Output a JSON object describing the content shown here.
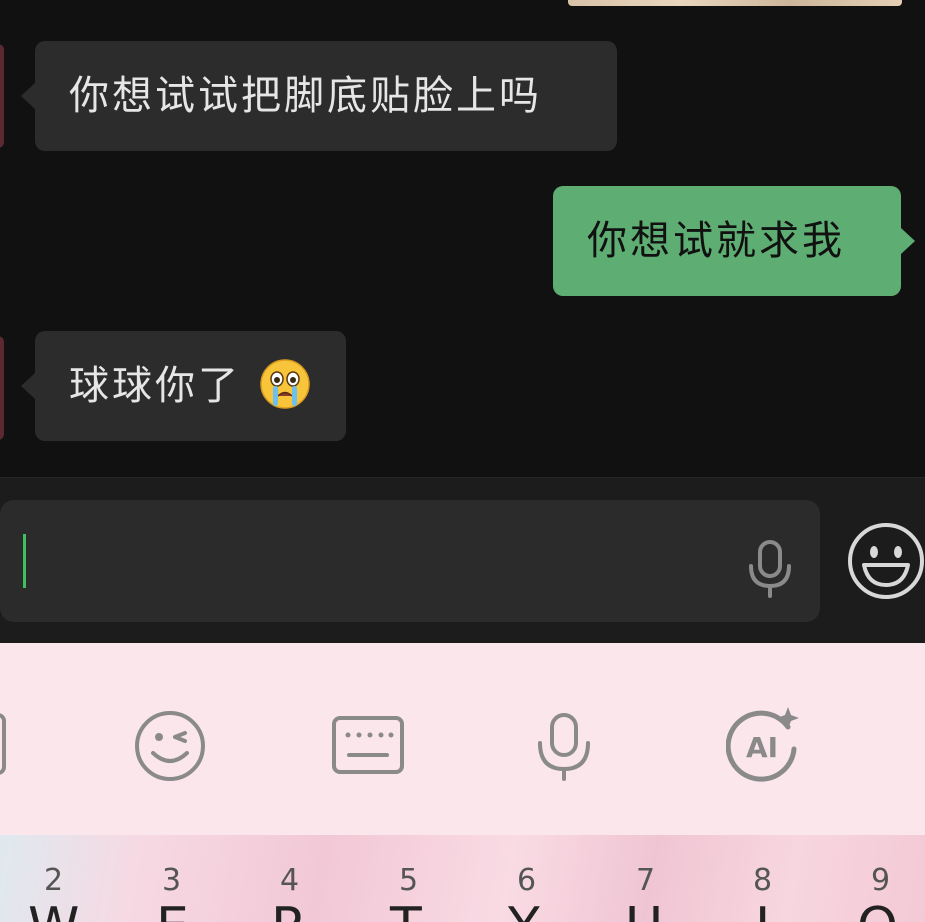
{
  "chat": {
    "messages": [
      {
        "side": "incoming",
        "text": "你想试试把脚底贴脸上吗"
      },
      {
        "side": "outgoing",
        "text": "你想试就求我"
      },
      {
        "side": "incoming",
        "text": "球球你了",
        "emoji": "loudly-crying-face-emoji"
      }
    ]
  },
  "input": {
    "value": "",
    "icons": [
      "microphone-icon",
      "smiley-face-icon"
    ]
  },
  "keyboard": {
    "toolbar_icons": [
      "wink-emoji-icon",
      "keyboard-icon",
      "microphone-icon",
      "ai-sparkle-icon"
    ],
    "number_row": [
      "2",
      "3",
      "4",
      "5",
      "6",
      "7",
      "8",
      "9"
    ],
    "letter_row": [
      "W",
      "E",
      "R",
      "T",
      "Y",
      "U",
      "I",
      "O"
    ]
  },
  "colors": {
    "background": "#111111",
    "incoming_bubble": "#2c2c2c",
    "outgoing_bubble": "#5ead73",
    "caret": "#3fbf5f",
    "keyboard_bg": "#fbe6ec"
  }
}
